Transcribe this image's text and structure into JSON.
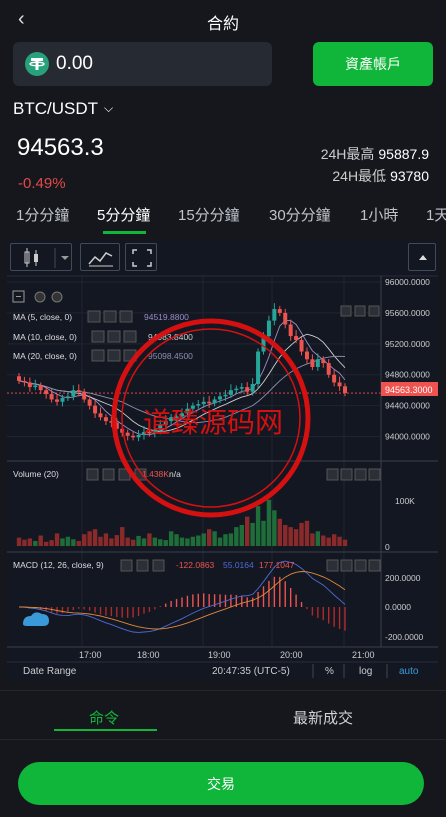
{
  "header": {
    "title": "合約",
    "back_icon": "chevron-left-icon"
  },
  "balance": {
    "value": "0.00",
    "icon": "usdt-tether-icon",
    "asset_button": "資產帳戶"
  },
  "ticker": {
    "pair": "BTC/USDT",
    "price": "94563.3",
    "change": "-0.49%",
    "high_label": "24H最高",
    "high_value": "95887.9",
    "low_label": "24H最低",
    "low_value": "93780"
  },
  "timeframes": [
    {
      "label": "1分分鐘"
    },
    {
      "label": "5分分鐘"
    },
    {
      "label": "15分分鐘"
    },
    {
      "label": "30分分鐘"
    },
    {
      "label": "1小時"
    },
    {
      "label": "1天"
    }
  ],
  "chart": {
    "price_axis": [
      "96000.0000",
      "95600.0000",
      "95200.0000",
      "94800.0000",
      "94400.0000",
      "94000.0000"
    ],
    "last_price_tag": "94563.3000",
    "ma5": {
      "label": "MA (5, close, 0)",
      "value": "94519.8800"
    },
    "ma10": {
      "label": "MA (10, close, 0)",
      "value": "94983.8400"
    },
    "ma20": {
      "label": "MA (20, close, 0)",
      "value": "95098.4500"
    },
    "volume": {
      "label": "Volume (20)",
      "value": "1.438K",
      "na": "n/a",
      "axis": [
        "100K",
        "0"
      ]
    },
    "macd": {
      "label": "MACD (12, 26, close, 9)",
      "values": [
        "-122.0863",
        "55.0164",
        "177.1047"
      ],
      "axis": [
        "200.0000",
        "0.0000",
        "-200.0000"
      ]
    },
    "time_axis": [
      "17:00",
      "18:00",
      "19:00",
      "20:00",
      "21:00"
    ],
    "footer": {
      "range": "Date Range",
      "clock": "20:47:35 (UTC-5)",
      "pct": "%",
      "log": "log",
      "auto": "auto"
    },
    "colors": {
      "up": "#26a69a",
      "down": "#ef5350",
      "ma5": "#9c8cc8",
      "ma10": "#cfcfcf",
      "ma20": "#8a8fb0"
    }
  },
  "watermark": {
    "text": "道臻源码网"
  },
  "tabs": {
    "orders": "命令",
    "latest": "最新成交"
  },
  "trade_button": "交易"
}
